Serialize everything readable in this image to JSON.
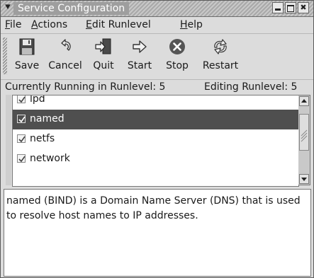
{
  "window": {
    "title": "Service Configuration",
    "controls": {
      "minimize": "‒",
      "maximize": "□",
      "close": "✖"
    }
  },
  "menubar": {
    "items": [
      {
        "label": "File",
        "mnemonic": "F",
        "rest": "ile"
      },
      {
        "label": "Actions",
        "mnemonic": "A",
        "rest": "ctions"
      },
      {
        "label": "Edit Runlevel",
        "mnemonic": "E",
        "rest": "dit Runlevel"
      },
      {
        "label": "Help",
        "mnemonic": "H",
        "rest": "elp"
      }
    ]
  },
  "toolbar": {
    "buttons": [
      {
        "label": "Save",
        "icon": "floppy-disk-icon"
      },
      {
        "label": "Cancel",
        "icon": "undo-arrow-icon"
      },
      {
        "label": "Quit",
        "icon": "exit-door-icon"
      },
      {
        "label": "Start",
        "icon": "right-arrow-icon"
      },
      {
        "label": "Stop",
        "icon": "stop-x-icon"
      },
      {
        "label": "Restart",
        "icon": "restart-arrows-icon"
      }
    ]
  },
  "status": {
    "running": "Currently Running in Runlevel: 5",
    "editing": "Editing Runlevel: 5"
  },
  "services": [
    {
      "name": "lpd",
      "checked": true,
      "selected": false
    },
    {
      "name": "named",
      "checked": true,
      "selected": true
    },
    {
      "name": "netfs",
      "checked": true,
      "selected": false
    },
    {
      "name": "network",
      "checked": true,
      "selected": false
    }
  ],
  "description": "named (BIND) is a Domain Name Server (DNS) that is used to resolve host names to IP addresses.",
  "colors": {
    "selection": "#4f4f4f",
    "window_bg": "#dcdcdc",
    "list_bg": "#ffffff"
  }
}
